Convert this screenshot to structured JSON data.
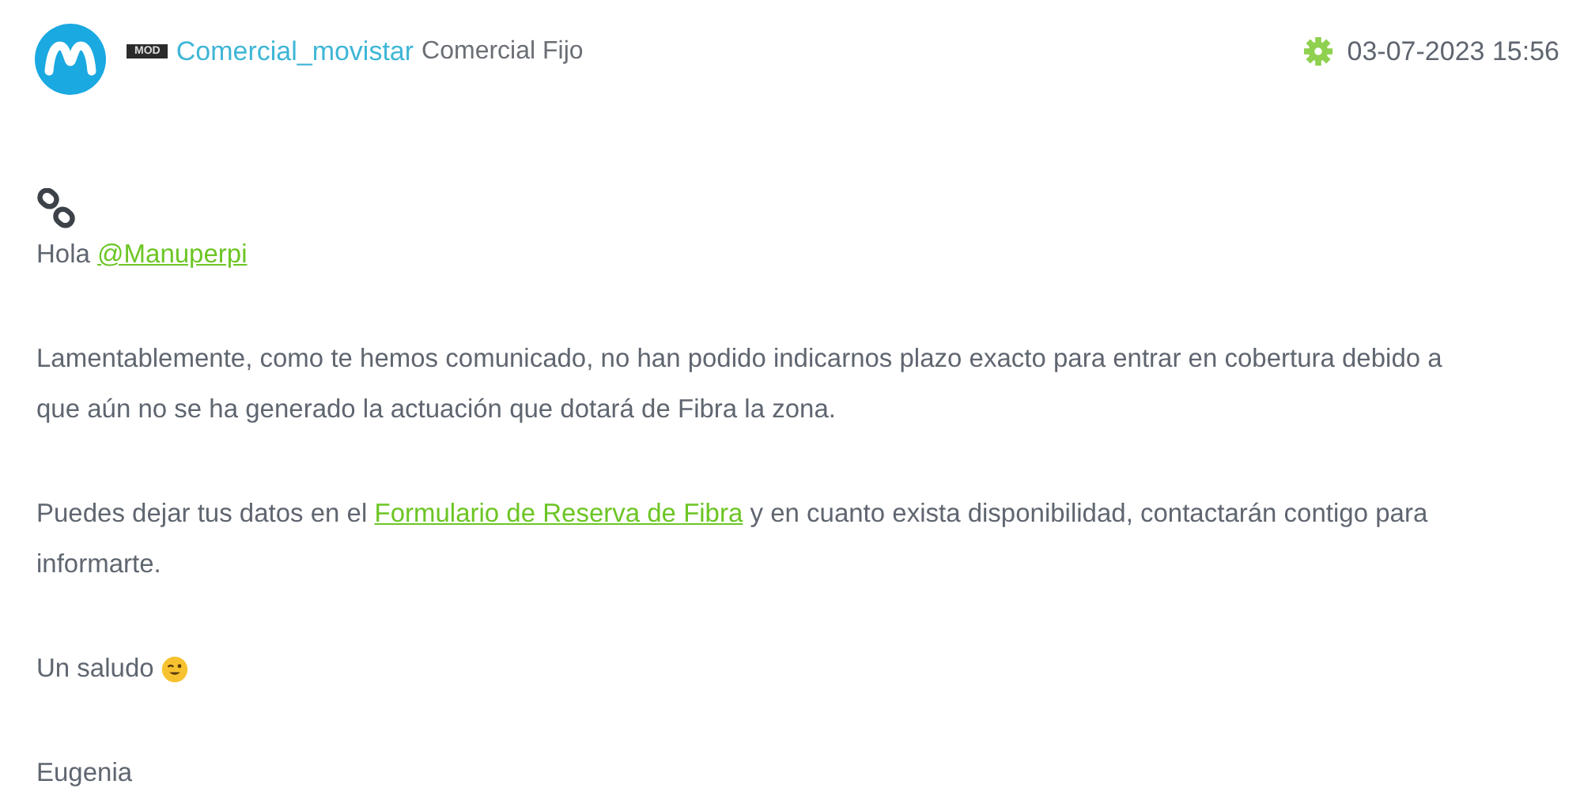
{
  "author": {
    "badge": "MOD",
    "name": "Comercial_movistar",
    "role": "Comercial Fijo"
  },
  "timestamp": "03-07-2023 15:56",
  "paragraphs": [
    [
      {
        "kind": "text",
        "text": "Hola "
      },
      {
        "kind": "link",
        "text": "@Manuperpi"
      }
    ],
    [
      {
        "kind": "text",
        "text": "Lamentablemente, como te hemos comunicado, no han podido indicarnos plazo exacto para entrar en cobertura debido a que aún no se ha generado la actuación que dotará de Fibra la zona."
      }
    ],
    [
      {
        "kind": "text",
        "text": "Puedes dejar tus datos en el "
      },
      {
        "kind": "link",
        "text": "Formulario de Reserva de Fibra"
      },
      {
        "kind": "text",
        "text": " y en cuanto exista disponibilidad, contactarán contigo para informarte."
      }
    ],
    [
      {
        "kind": "text",
        "text": "Un saludo "
      },
      {
        "kind": "emoji"
      }
    ],
    [
      {
        "kind": "text",
        "text": "Eugenia"
      }
    ]
  ]
}
